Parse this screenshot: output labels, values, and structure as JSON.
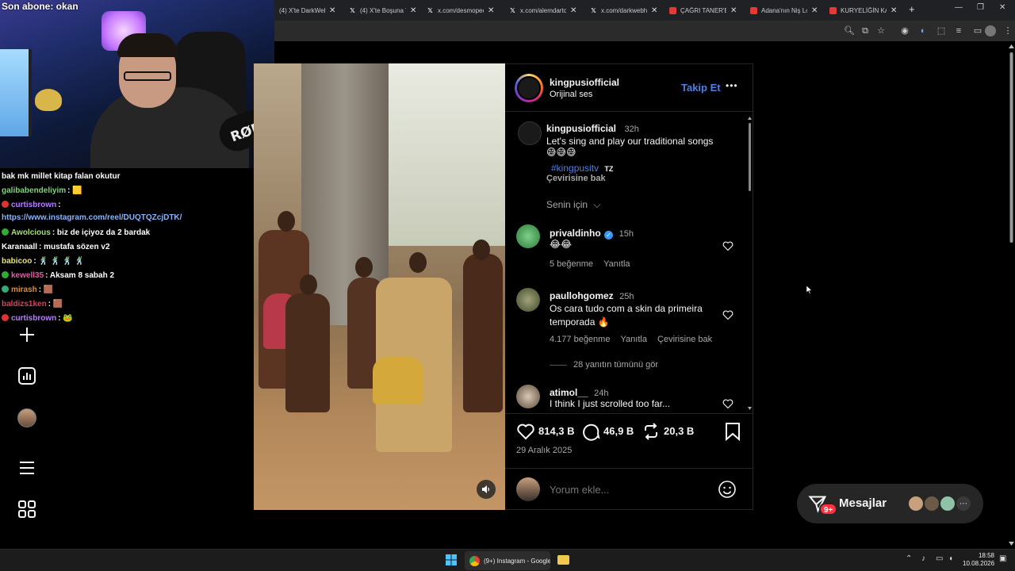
{
  "browser": {
    "tabs": [
      {
        "title": "(4) X'te DarkWeb",
        "icon": "x-logo-icon"
      },
      {
        "title": "(4) X'te Boşuna T",
        "icon": "x-logo-icon"
      },
      {
        "title": "x.com/desmopec",
        "icon": "x-logo-icon"
      },
      {
        "title": "x.com/alemdarto",
        "icon": "x-logo-icon"
      },
      {
        "title": "x.com/darkwebh",
        "icon": "x-logo-icon"
      },
      {
        "title": "ÇAĞRI TANER'E",
        "icon": "youtube-icon"
      },
      {
        "title": "Adana'nın Niş Lo",
        "icon": "youtube-icon"
      },
      {
        "title": "KURYELİĞİN KAR",
        "icon": "youtube-icon"
      }
    ],
    "new_tab": "+"
  },
  "stream": {
    "sub_label": "Son abone: okan",
    "mic_brand": "RØDE",
    "chat": [
      {
        "nick": "",
        "msg": "bak mk millet kitap falan okutur",
        "color": "#ffffff",
        "badge": ""
      },
      {
        "nick": "galibabendeliyim",
        "msg": ": 🟨",
        "color": "#7fd17f",
        "badge": ""
      },
      {
        "nick": "curtisbrown",
        "msg": ":",
        "color": "#b57fff",
        "badge": "#d33"
      },
      {
        "nick": "",
        "msg": "https://www.instagram.com/reel/DUQTQZcjDTK/",
        "color": "#8ab4f8",
        "badge": "",
        "link": true
      },
      {
        "nick": "Awolcious",
        "msg": ": biz de içiyoz da 2 bardak",
        "color": "#9fe26a",
        "badge": "#3a3"
      },
      {
        "nick": "Karanaall",
        "msg": ": mustafa sözen v2",
        "color": "#ffffff",
        "badge": ""
      },
      {
        "nick": "babicoo",
        "msg": ": 🕺 🕺 🕺 🕺",
        "color": "#e8e36a",
        "badge": ""
      },
      {
        "nick": "kewell35",
        "msg": ": Aksam 8 sabah 2",
        "color": "#e35aa0",
        "badge": "#3a3"
      },
      {
        "nick": "mirash",
        "msg": ": 🟫",
        "color": "#e88c2a",
        "badge": "#3a7"
      },
      {
        "nick": "baldizs1ken",
        "msg": ": 🟫",
        "color": "#e33b5c",
        "badge": ""
      },
      {
        "nick": "curtisbrown",
        "msg": ": 🐸",
        "color": "#b57fff",
        "badge": "#d33"
      }
    ]
  },
  "post": {
    "header": {
      "username": "kingpusiofficial",
      "audio": "Orijinal ses",
      "follow": "Takip Et",
      "more": "•••"
    },
    "caption": {
      "username": "kingpusiofficial",
      "time": "32h",
      "text": "Let's sing and play our traditional songs",
      "emojis": "😅😅😅",
      "hashtag": "#kingpusitv",
      "country": "TZ",
      "translate": "Çevirisine bak"
    },
    "filter": "Senin için",
    "comments": [
      {
        "username": "privaldinho",
        "verified": true,
        "time": "15h",
        "text": "😂😂",
        "likes": "5 beğenme",
        "reply": "Yanıtla",
        "translate": ""
      },
      {
        "username": "paullohgomez",
        "verified": false,
        "time": "25h",
        "text": "Os cara tudo com a skin da primeira temporada 🔥",
        "likes": "4.177 beğenme",
        "reply": "Yanıtla",
        "translate": "Çevirisine bak",
        "view_replies": "28 yanıtın tümünü gör"
      },
      {
        "username": "atimol__",
        "verified": false,
        "time": "24h",
        "text": "I think I just scrolled too far...",
        "likes": "",
        "reply": "",
        "translate": ""
      }
    ],
    "stats": {
      "likes": "814,3 B",
      "comments": "46,9 B",
      "reposts": "20,3 B"
    },
    "date": "29 Aralık 2025",
    "comment_placeholder": "Yorum ekle..."
  },
  "messages": {
    "label": "Mesajlar",
    "badge": "9+"
  },
  "taskbar": {
    "app_title": "(9+) Instagram - Google",
    "time": "18:58",
    "date": "10.08.2026"
  },
  "colors": {
    "accent_blue": "#4c7fe8",
    "link_blue": "#8ab4f8",
    "badge_red": "#ff3040"
  }
}
